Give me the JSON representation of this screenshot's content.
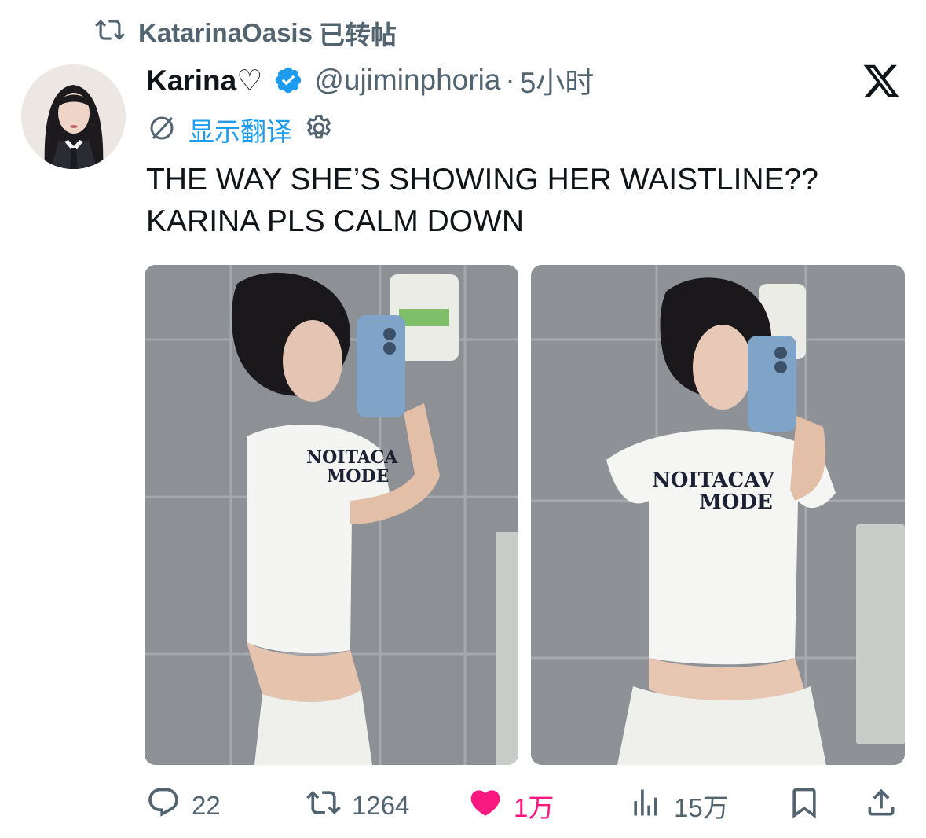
{
  "repost": {
    "user": "KatarinaOasis",
    "suffix": "已转帖"
  },
  "author": {
    "display_name": "Karina♡",
    "handle": "@ujiminphoria",
    "separator": "·",
    "time": "5小时"
  },
  "translate": {
    "label": "显示翻译"
  },
  "tweet": {
    "line1": "THE WAY SHE’S SHOWING HER WAISTLINE??",
    "line2": "KARINA PLS CALM DOWN"
  },
  "media": [
    {
      "shirt_text_line1": "NOITA​CA",
      "shirt_text_line2": "MODE"
    },
    {
      "shirt_text_line1": "NOITACAV",
      "shirt_text_line2": "MODE"
    }
  ],
  "actions": {
    "replies": "22",
    "reposts": "1264",
    "likes": "1万",
    "views": "15万"
  },
  "colors": {
    "accent": "#1d9bf0",
    "like": "#f91880",
    "muted": "#536471",
    "text": "#0f1419"
  }
}
